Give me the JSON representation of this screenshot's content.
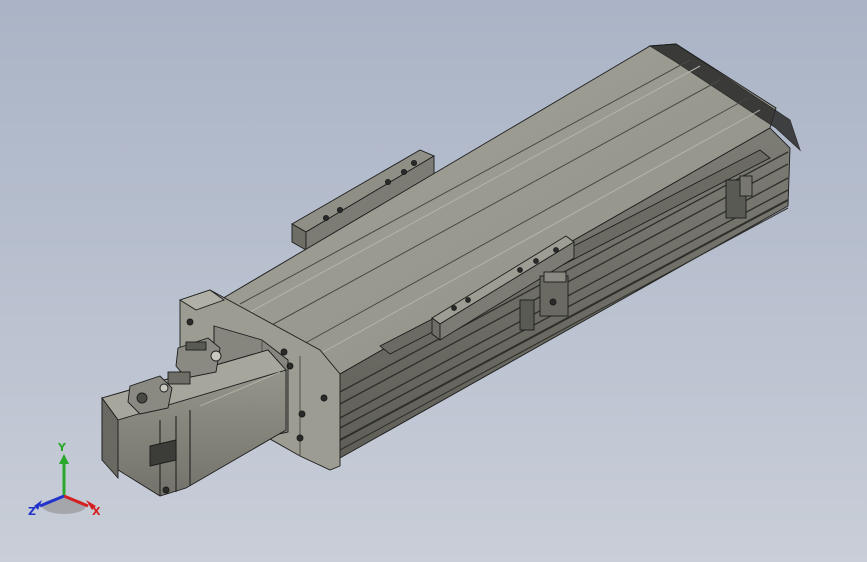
{
  "view": {
    "background_top": "#aab4c6",
    "background_bottom": "#c9ced8",
    "model_color": "#8e8e84",
    "model_shadow_color": "#6e6e66",
    "edge_color": "#1c1c1c"
  },
  "triad": {
    "x_label": "X",
    "y_label": "Y",
    "z_label": "Z",
    "x_color": "#d42020",
    "y_color": "#2aa82a",
    "z_color": "#2233cc"
  }
}
